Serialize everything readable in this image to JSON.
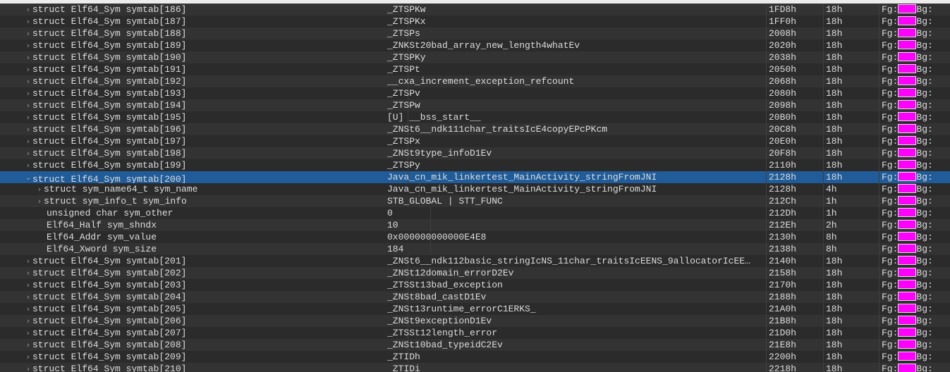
{
  "colors": {
    "fg_swatch": "#ff00ff",
    "row_even": "#333333",
    "row_odd": "#2b2b2b",
    "row_selected": "#1f5c99"
  },
  "labels": {
    "fg": "Fg:",
    "bg": "Bg:"
  },
  "rows": [
    {
      "name": "struct Elf64_Sym symtab[186]",
      "value": "_ZTSPKw",
      "start": "1FD8h",
      "size": "18h",
      "level": 0,
      "expandable": true,
      "expanded": false
    },
    {
      "name": "struct Elf64_Sym symtab[187]",
      "value": "_ZTSPKx",
      "start": "1FF0h",
      "size": "18h",
      "level": 0,
      "expandable": true,
      "expanded": false
    },
    {
      "name": "struct Elf64_Sym symtab[188]",
      "value": "_ZTSPs",
      "start": "2008h",
      "size": "18h",
      "level": 0,
      "expandable": true,
      "expanded": false
    },
    {
      "name": "struct Elf64_Sym symtab[189]",
      "value": "_ZNKSt20bad_array_new_length4whatEv",
      "start": "2020h",
      "size": "18h",
      "level": 0,
      "expandable": true,
      "expanded": false
    },
    {
      "name": "struct Elf64_Sym symtab[190]",
      "value": "_ZTSPKy",
      "start": "2038h",
      "size": "18h",
      "level": 0,
      "expandable": true,
      "expanded": false
    },
    {
      "name": "struct Elf64_Sym symtab[191]",
      "value": "_ZTSPt",
      "start": "2050h",
      "size": "18h",
      "level": 0,
      "expandable": true,
      "expanded": false
    },
    {
      "name": "struct Elf64_Sym symtab[192]",
      "value": "__cxa_increment_exception_refcount",
      "start": "2068h",
      "size": "18h",
      "level": 0,
      "expandable": true,
      "expanded": false
    },
    {
      "name": "struct Elf64_Sym symtab[193]",
      "value": "_ZTSPv",
      "start": "2080h",
      "size": "18h",
      "level": 0,
      "expandable": true,
      "expanded": false
    },
    {
      "name": "struct Elf64_Sym symtab[194]",
      "value": "_ZTSPw",
      "start": "2098h",
      "size": "18h",
      "level": 0,
      "expandable": true,
      "expanded": false
    },
    {
      "name": "struct Elf64_Sym symtab[195]",
      "value": "[U] __bss_start__",
      "start": "20B0h",
      "size": "18h",
      "level": 0,
      "expandable": true,
      "expanded": false
    },
    {
      "name": "struct Elf64_Sym symtab[196]",
      "value": "_ZNSt6__ndk111char_traitsIcE4copyEPcPKcm",
      "start": "20C8h",
      "size": "18h",
      "level": 0,
      "expandable": true,
      "expanded": false
    },
    {
      "name": "struct Elf64_Sym symtab[197]",
      "value": "_ZTSPx",
      "start": "20E0h",
      "size": "18h",
      "level": 0,
      "expandable": true,
      "expanded": false
    },
    {
      "name": "struct Elf64_Sym symtab[198]",
      "value": "_ZNSt9type_infoD1Ev",
      "start": "20F8h",
      "size": "18h",
      "level": 0,
      "expandable": true,
      "expanded": false
    },
    {
      "name": "struct Elf64_Sym symtab[199]",
      "value": "_ZTSPy",
      "start": "2110h",
      "size": "18h",
      "level": 0,
      "expandable": true,
      "expanded": false
    },
    {
      "name": "struct Elf64_Sym symtab[200]",
      "value": "Java_cn_mik_linkertest_MainActivity_stringFromJNI",
      "start": "2128h",
      "size": "18h",
      "level": 0,
      "expandable": true,
      "expanded": true,
      "selected": true
    },
    {
      "name": "struct sym_name64_t sym_name",
      "value": "Java_cn_mik_linkertest_MainActivity_stringFromJNI",
      "start": "2128h",
      "size": "4h",
      "level": 1,
      "expandable": true,
      "expanded": false
    },
    {
      "name": "struct sym_info_t sym_info",
      "value": "STB_GLOBAL | STT_FUNC",
      "start": "212Ch",
      "size": "1h",
      "level": 1,
      "expandable": true,
      "expanded": false
    },
    {
      "name": "unsigned char sym_other",
      "value": "0",
      "start": "212Dh",
      "size": "1h",
      "level": 1,
      "expandable": false
    },
    {
      "name": "Elf64_Half sym_shndx",
      "value": "10",
      "start": "212Eh",
      "size": "2h",
      "level": 1,
      "expandable": false
    },
    {
      "name": "Elf64_Addr sym_value",
      "value": "0x000000000000E4E8",
      "start": "2130h",
      "size": "8h",
      "level": 1,
      "expandable": false
    },
    {
      "name": "Elf64_Xword sym_size",
      "value": "184",
      "start": "2138h",
      "size": "8h",
      "level": 1,
      "expandable": false
    },
    {
      "name": "struct Elf64_Sym symtab[201]",
      "value": "_ZNSt6__ndk112basic_stringIcNS_11char_traitsIcEENS_9allocatorIcEE…",
      "start": "2140h",
      "size": "18h",
      "level": 0,
      "expandable": true,
      "expanded": false
    },
    {
      "name": "struct Elf64_Sym symtab[202]",
      "value": "_ZNSt12domain_errorD2Ev",
      "start": "2158h",
      "size": "18h",
      "level": 0,
      "expandable": true,
      "expanded": false
    },
    {
      "name": "struct Elf64_Sym symtab[203]",
      "value": "_ZTSSt13bad_exception",
      "start": "2170h",
      "size": "18h",
      "level": 0,
      "expandable": true,
      "expanded": false
    },
    {
      "name": "struct Elf64_Sym symtab[204]",
      "value": "_ZNSt8bad_castD1Ev",
      "start": "2188h",
      "size": "18h",
      "level": 0,
      "expandable": true,
      "expanded": false
    },
    {
      "name": "struct Elf64_Sym symtab[205]",
      "value": "_ZNSt13runtime_errorC1ERKS_",
      "start": "21A0h",
      "size": "18h",
      "level": 0,
      "expandable": true,
      "expanded": false
    },
    {
      "name": "struct Elf64_Sym symtab[206]",
      "value": "_ZNSt9exceptionD1Ev",
      "start": "21B8h",
      "size": "18h",
      "level": 0,
      "expandable": true,
      "expanded": false
    },
    {
      "name": "struct Elf64_Sym symtab[207]",
      "value": "_ZTSSt12length_error",
      "start": "21D0h",
      "size": "18h",
      "level": 0,
      "expandable": true,
      "expanded": false
    },
    {
      "name": "struct Elf64_Sym symtab[208]",
      "value": "_ZNSt10bad_typeidC2Ev",
      "start": "21E8h",
      "size": "18h",
      "level": 0,
      "expandable": true,
      "expanded": false
    },
    {
      "name": "struct Elf64_Sym symtab[209]",
      "value": "_ZTIDh",
      "start": "2200h",
      "size": "18h",
      "level": 0,
      "expandable": true,
      "expanded": false
    },
    {
      "name": "struct Elf64_Sym symtab[210]",
      "value": "_ZTIDi",
      "start": "2218h",
      "size": "18h",
      "level": 0,
      "expandable": true,
      "expanded": false
    }
  ]
}
